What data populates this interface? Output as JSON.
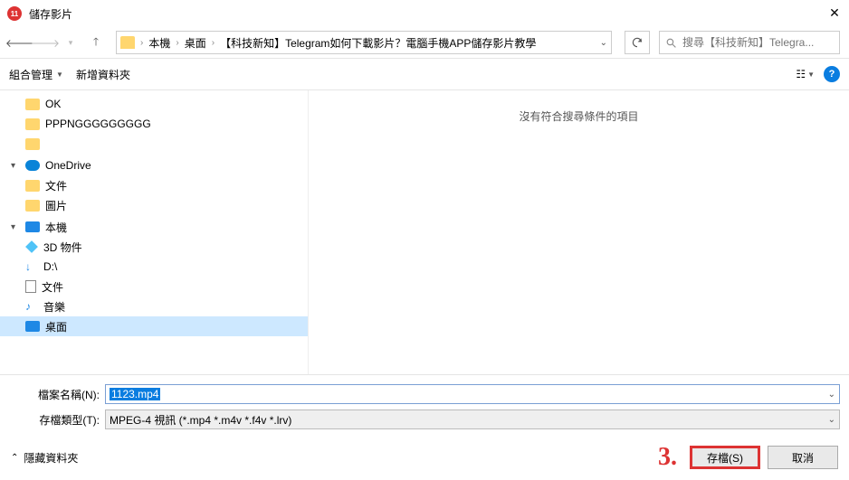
{
  "titlebar": {
    "title": "儲存影片"
  },
  "nav": {
    "breadcrumb": [
      "本機",
      "桌面",
      "【科技新知】Telegram如何下載影片？電腦手機APP儲存影片教學"
    ],
    "search_placeholder": "搜尋【科技新知】Telegra..."
  },
  "toolbar": {
    "organize": "組合管理",
    "newfolder": "新增資料夾"
  },
  "sidebar": {
    "items": [
      {
        "label": "OK",
        "icon": "folder",
        "indent": 1
      },
      {
        "label": "PPPNGGGGGGGGG",
        "icon": "folder",
        "indent": 1
      },
      {
        "label": "",
        "icon": "folder",
        "indent": 1
      },
      {
        "label": "OneDrive",
        "icon": "onedrive",
        "indent": 0,
        "expand": "▾"
      },
      {
        "label": "文件",
        "icon": "folder",
        "indent": 1
      },
      {
        "label": "圖片",
        "icon": "folder",
        "indent": 1
      },
      {
        "label": "本機",
        "icon": "pc",
        "indent": 0,
        "expand": "▾"
      },
      {
        "label": "3D 物件",
        "icon": "cube",
        "indent": 1
      },
      {
        "label": "D:\\",
        "icon": "download",
        "indent": 1
      },
      {
        "label": "文件",
        "icon": "doc",
        "indent": 1
      },
      {
        "label": "音樂",
        "icon": "music",
        "indent": 1
      },
      {
        "label": "桌面",
        "icon": "desk",
        "indent": 1,
        "selected": true
      }
    ]
  },
  "content": {
    "empty_msg": "沒有符合搜尋條件的項目"
  },
  "fields": {
    "filename_label": "檔案名稱(N):",
    "filename_value": "1123.mp4",
    "filetype_label": "存檔類型(T):",
    "filetype_value": "MPEG-4 視訊 (*.mp4 *.m4v *.f4v *.lrv)"
  },
  "footer": {
    "hide": "隱藏資料夾",
    "annotation": "3.",
    "save": "存檔(S)",
    "cancel": "取消"
  }
}
